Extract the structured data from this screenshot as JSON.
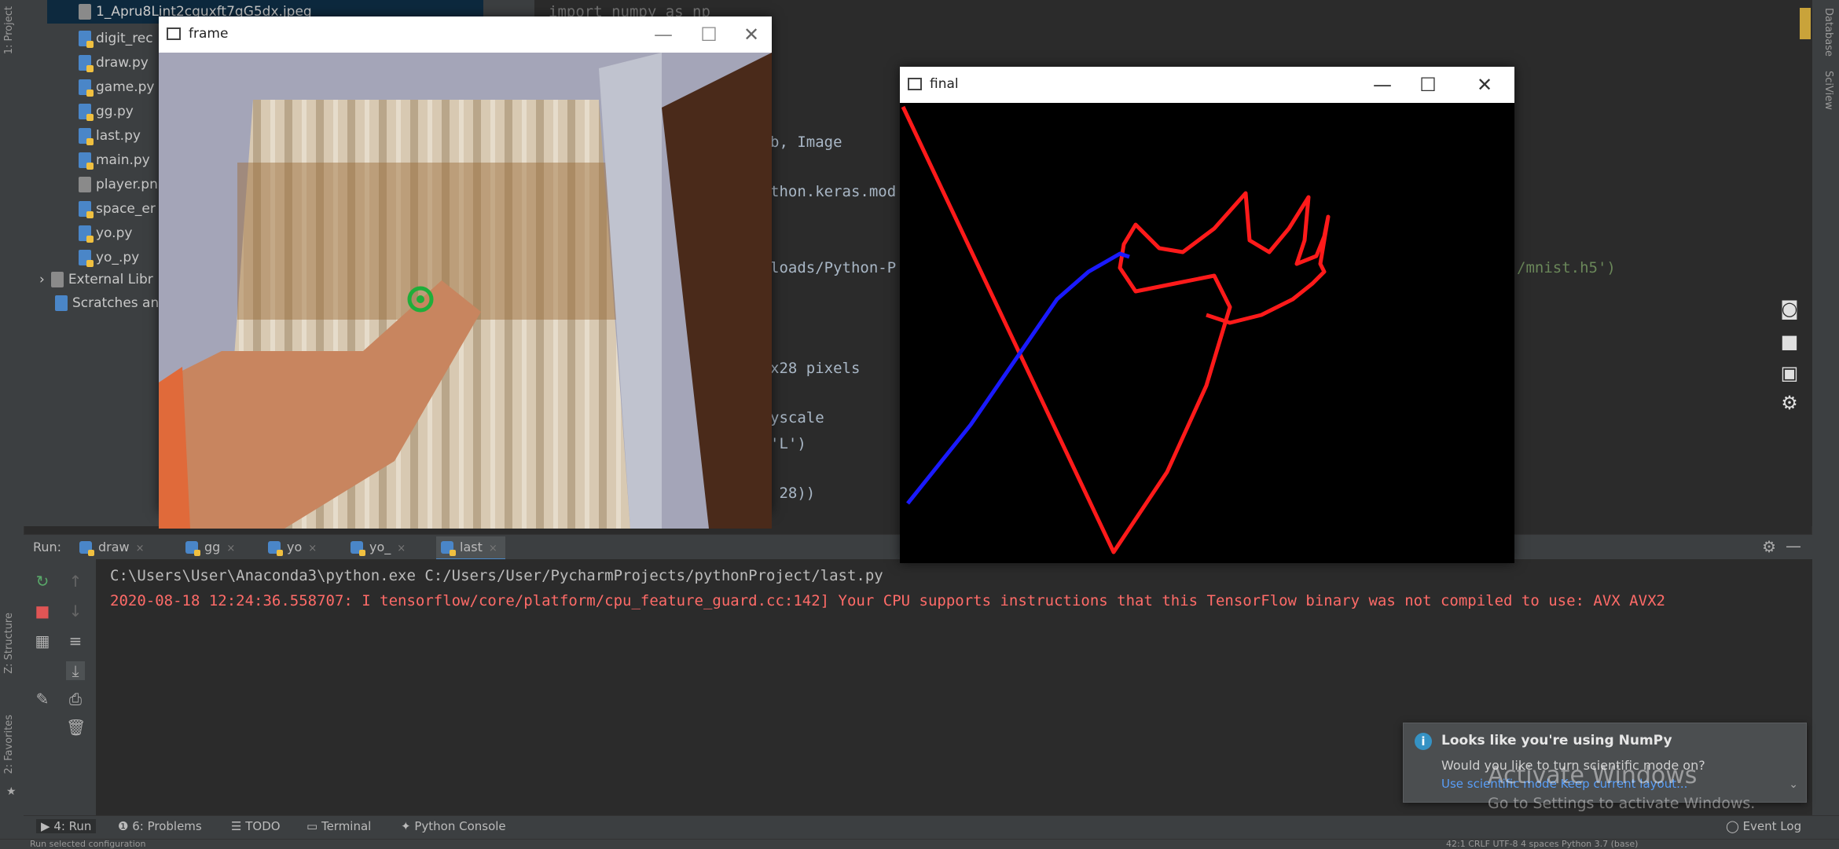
{
  "project_tree": {
    "selected_file": "1_Apru8Lint2cguxft7qG5dx.jpeg",
    "files": [
      "digit_rec",
      "draw.py",
      "game.py",
      "gg.py",
      "last.py",
      "main.py",
      "player.pn",
      "space_er",
      "yo.py",
      "yo_.py"
    ],
    "external_libraries": "External Libr",
    "scratches": "Scratches an"
  },
  "editor": {
    "lines": [
      {
        "code": "import numpy as np"
      },
      {
        "code": "b, Image"
      },
      {
        "code": "thon.keras.mod"
      },
      {
        "code": "loads/Python-P",
        "suffix": "/mnist.h5')"
      },
      {
        "code": "x28 pixels"
      },
      {
        "code": "yscale"
      },
      {
        "code": "'L')"
      },
      {
        "code": " 28))"
      }
    ]
  },
  "frame_window": {
    "title": "frame",
    "minimize": "—",
    "maximize": "☐",
    "close": "✕"
  },
  "final_window": {
    "title": "final",
    "minimize": "—",
    "maximize": "☐",
    "close": "✕"
  },
  "run_panel": {
    "label": "Run:",
    "tabs": [
      "draw",
      "gg",
      "yo",
      "yo_",
      "last"
    ],
    "active_tab": "last",
    "console": [
      "C:\\Users\\User\\Anaconda3\\python.exe C:/Users/User/PycharmProjects/pythonProject/last.py",
      "2020-08-18 12:24:36.558707: I tensorflow/core/platform/cpu_feature_guard.cc:142] Your CPU supports instructions that this TensorFlow binary was not compiled to use: AVX AVX2"
    ]
  },
  "bottom_tabs": [
    "4: Run",
    "6: Problems",
    "TODO",
    "Terminal",
    "Python Console",
    "Event Log"
  ],
  "left_strip_labels": [
    "1: Project",
    "Z: Structure",
    "2: Favorites"
  ],
  "notification": {
    "title": "Looks like you're using NumPy",
    "body": "Would you like to turn scientific mode on?",
    "link": "Use scientific mode   Keep current layout..."
  },
  "watermark": {
    "title": "Activate Windows",
    "subtitle": "Go to Settings to activate Windows."
  },
  "status_bar": {
    "left": "Run selected configuration",
    "right": "42:1   CRLF   UTF-8   4 spaces   Python 3.7 (base)"
  },
  "colors": {
    "red_stroke": "#ff1a1a",
    "blue_stroke": "#1a1aff",
    "error_text": "#ff6b68",
    "console_text": "#bbbbbb"
  }
}
